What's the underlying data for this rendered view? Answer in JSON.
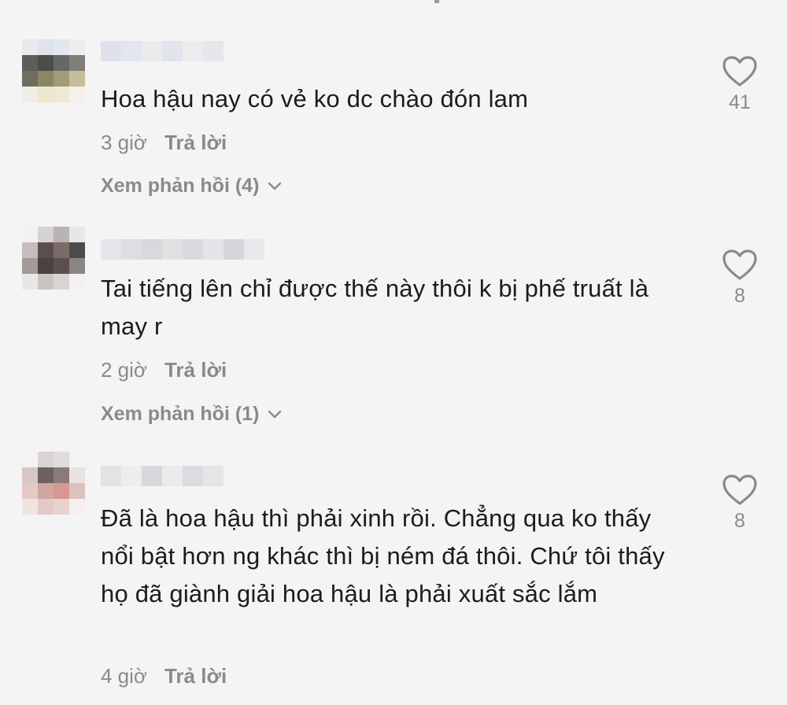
{
  "comments": [
    {
      "text": "Hoa hậu nay có vẻ ko dc chào đón lam",
      "time": "3 giờ",
      "reply_label": "Trả lời",
      "view_replies": "Xem phản hồi (4)",
      "likes": "41"
    },
    {
      "text": "Tai tiếng lên chỉ được thế này thôi k bị phế truất là may r",
      "time": "2 giờ",
      "reply_label": "Trả lời",
      "view_replies": "Xem phản hồi (1)",
      "likes": "8"
    },
    {
      "text": "Đã là hoa hậu thì phải xinh rồi. Chẳng qua ko thấy nổi bật hơn ng khác thì bị ném đá thôi. Chứ tôi thấy họ đã giành giải hoa hậu là phải xuất sắc lắm",
      "time": "4 giờ",
      "reply_label": "Trả lời",
      "likes": "8"
    }
  ],
  "colors": {
    "background": "#f4f4f4",
    "text": "#1c1c1c",
    "meta": "#8a8a8a",
    "heart_outline": "#8a8a8a"
  },
  "icons": {
    "like": "heart-outline-icon",
    "expand": "chevron-down-icon"
  }
}
